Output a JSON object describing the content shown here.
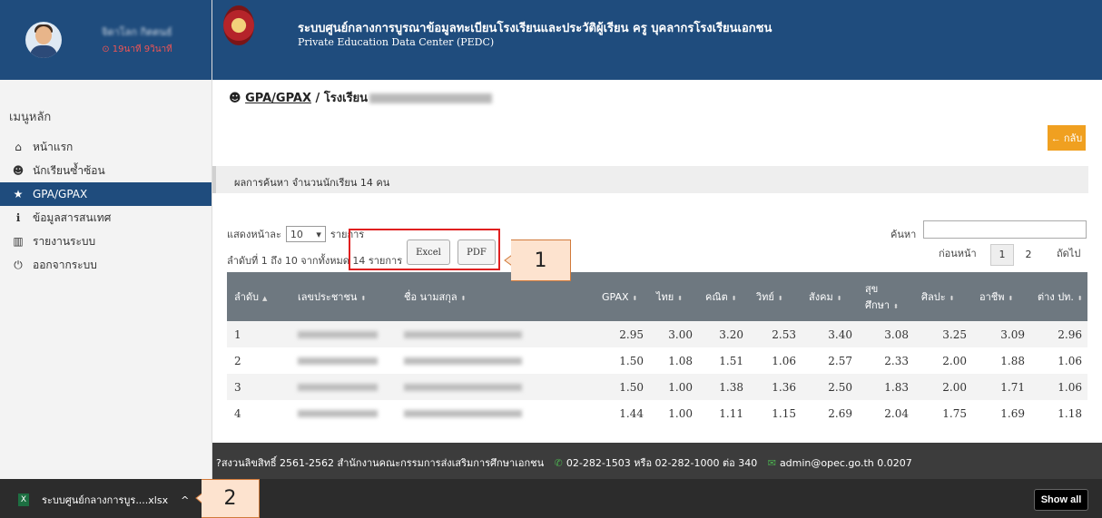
{
  "sidebar": {
    "user_name": "จิดาโลก กิตตนธ์",
    "user_time": "19นาที 9วินาที",
    "menu_title": "เมนูหลัก",
    "items": [
      {
        "label": "หน้าแรก",
        "icon": "home-icon",
        "glyph": "⌂"
      },
      {
        "label": "นักเรียนซ้ำซ้อน",
        "icon": "users-icon",
        "glyph": "☻"
      },
      {
        "label": "GPA/GPAX",
        "icon": "star-icon",
        "glyph": "★"
      },
      {
        "label": "ข้อมูลสารสนเทศ",
        "icon": "info-icon",
        "glyph": "ℹ"
      },
      {
        "label": "รายงานระบบ",
        "icon": "bar-chart-icon",
        "glyph": "▥"
      },
      {
        "label": "ออกจากระบบ",
        "icon": "power-icon",
        "glyph": "⏻"
      }
    ]
  },
  "header": {
    "title": "ระบบศูนย์กลางการบูรณาข้อมูลทะเบียนโรงเรียนและประวัติผู้เรียน ครู บุคลากรโรงเรียนเอกชน",
    "subtitle": "Private Education Data Center (PEDC)"
  },
  "main": {
    "crumb_link": "GPA/GPAX",
    "crumb_sep": " / ",
    "crumb_school": "โรงเรียน",
    "back_label": "← กลับ",
    "result_text": "ผลการค้นหา จำนวนนักเรียน 14 คน",
    "show_prefix": "แสดงหน้าละ",
    "show_value": "10",
    "show_suffix": "รายการ",
    "search_label": "ค้นหา",
    "info_text": "ลำดับที่ 1 ถึง 10 จากทั้งหมด 14 รายการ",
    "excel_label": "Excel",
    "pdf_label": "PDF",
    "pager_prev": "ก่อนหน้า",
    "pager_next": "ถัดไป",
    "page1": "1",
    "page2": "2"
  },
  "table": {
    "headers": [
      "ลำดับ",
      "เลขประชาชน",
      "ชื่อ นามสกุล",
      "GPAX",
      "ไทย",
      "คณิต",
      "วิทย์",
      "สังคม",
      "สุข ศึกษา",
      "ศิลปะ",
      "อาชีพ",
      "ต่าง ปท."
    ],
    "rows": [
      [
        "1",
        "2.95",
        "3.00",
        "3.20",
        "2.53",
        "3.40",
        "3.08",
        "3.25",
        "3.09",
        "2.96"
      ],
      [
        "2",
        "1.50",
        "1.08",
        "1.51",
        "1.06",
        "2.57",
        "2.33",
        "2.00",
        "1.88",
        "1.06"
      ],
      [
        "3",
        "1.50",
        "1.00",
        "1.38",
        "1.36",
        "2.50",
        "1.83",
        "2.00",
        "1.71",
        "1.06"
      ],
      [
        "4",
        "1.44",
        "1.00",
        "1.11",
        "1.15",
        "2.69",
        "2.04",
        "1.75",
        "1.69",
        "1.18"
      ]
    ]
  },
  "footer": {
    "copyright": "?สงวนลิขสิทธิ์ 2561-2562 สำนักงานคณะกรรมการส่งเสริมการศึกษาเอกชน",
    "phone": "02-282-1503 หรือ 02-282-1000 ต่อ 340",
    "email": "admin@opec.go.th 0.0207"
  },
  "download_bar": {
    "file_name": "ระบบศูนย์กลางการบูร....xlsx",
    "chevron": "^",
    "show_all": "Show all"
  },
  "callouts": {
    "one": "1",
    "two": "2"
  },
  "colors": {
    "header": "#1f4c7d",
    "accent": "#f0a020",
    "table_head": "#6e7880",
    "highlight": "#e02020",
    "callout_fill": "#fde3cf"
  }
}
